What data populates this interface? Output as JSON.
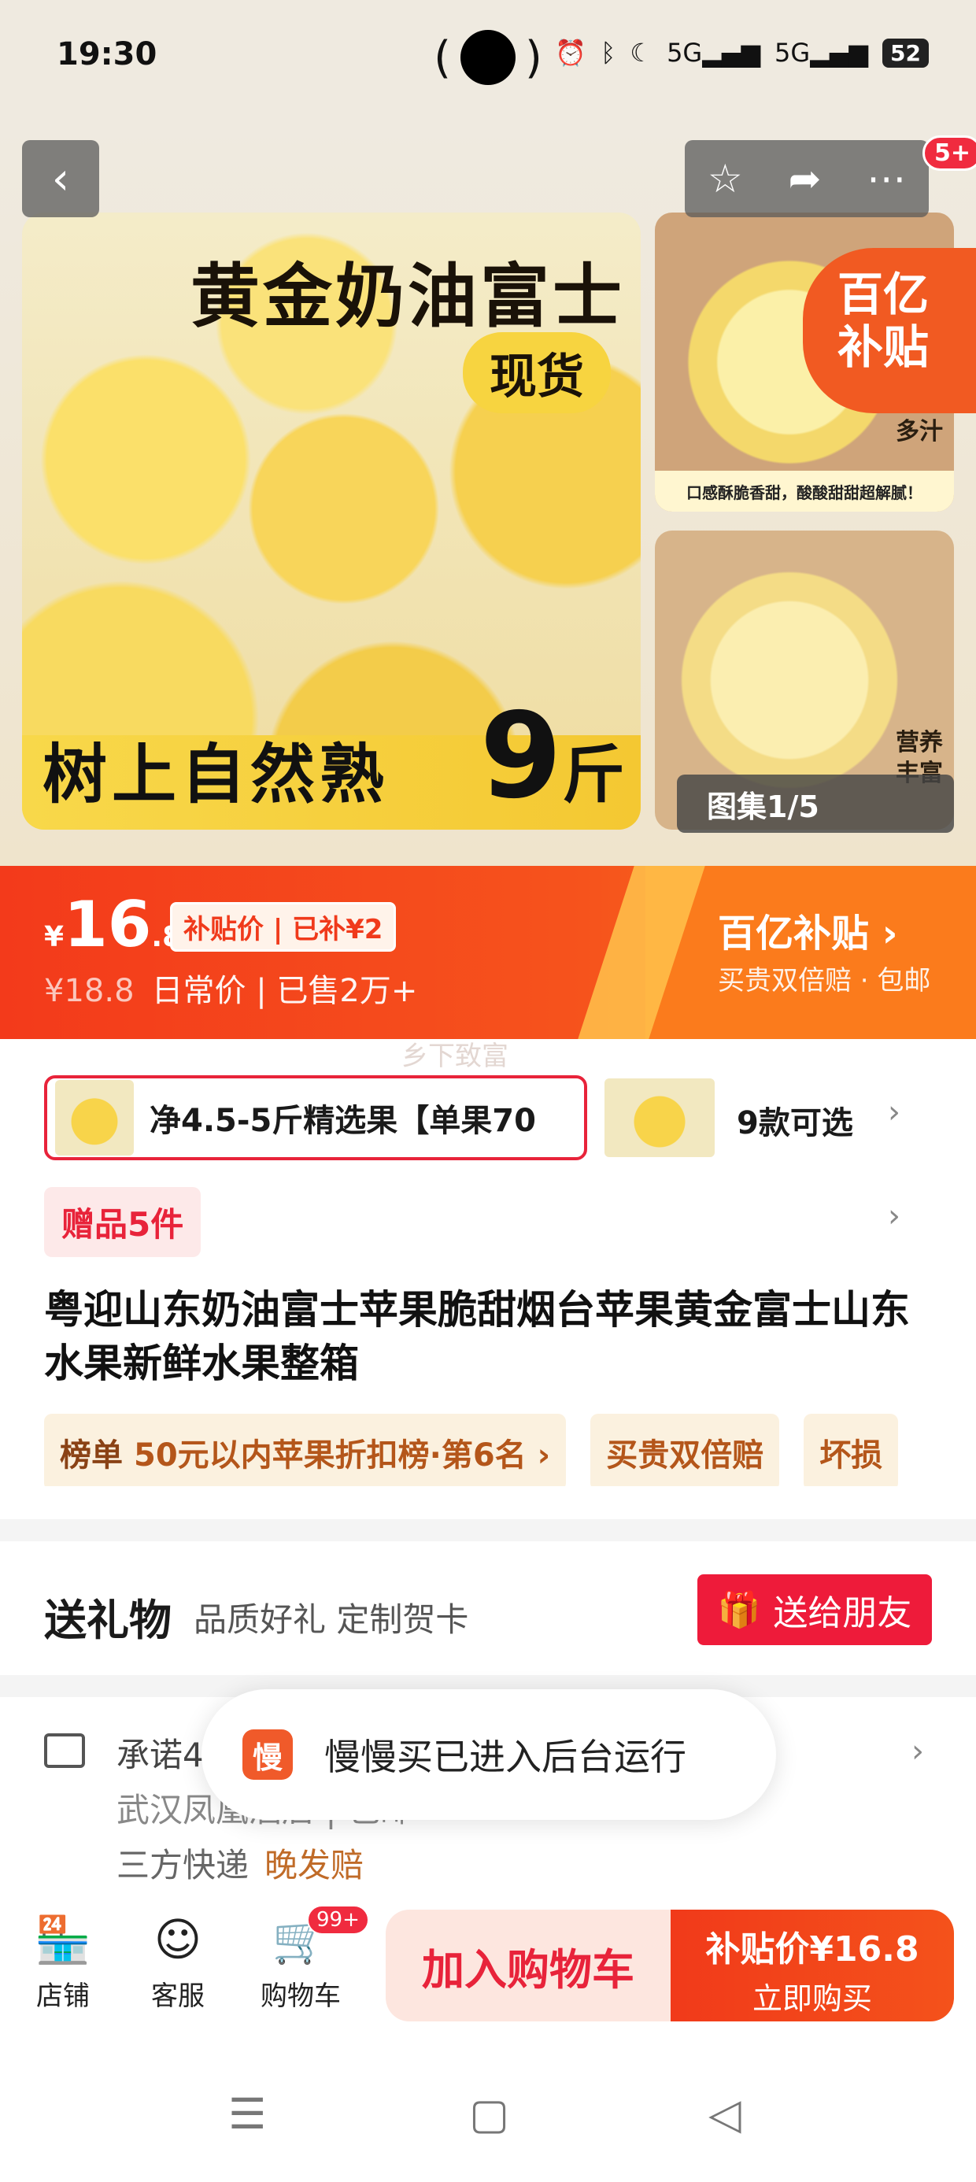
{
  "status_bar": {
    "time": "19:30",
    "camera": "( )",
    "net1": "5G",
    "net2": "5G",
    "battery": "52"
  },
  "gallery": {
    "badge": "5+",
    "main_title": "黄金奶油富士",
    "in_stock": "现货",
    "bottom_text": "树上自然熟",
    "weight_num": "9",
    "weight_unit": "斤",
    "thumb1_note": "松脆\n多汁",
    "thumb1_strip": "口感酥脆香甜，酸酸甜甜超解腻！",
    "subsidy_seal": "百亿\n补贴",
    "thumb2_note": "营养\n丰富",
    "album": "图集1/5"
  },
  "price": {
    "currency": "¥",
    "integer": "16",
    "decimal": ".8",
    "tag": "补贴价 | 已补¥2",
    "original": "¥18.8",
    "daily_label": "日常价",
    "sold": "| 已售2万+",
    "brand": "百亿补贴",
    "brand_sub": "买贵双倍赔 · 包邮"
  },
  "watermark": "乡下致富",
  "sku": {
    "selected_label": "净4.5-5斤精选果【单果70",
    "count": "9款可选"
  },
  "gift": {
    "chip": "赠品5件"
  },
  "product": {
    "title": "粤迎山东奶油富士苹果脆甜烟台苹果黄金富士山东水果新鲜水果整箱"
  },
  "chips": [
    {
      "prefix": "榜单",
      "text": "50元以内苹果折扣榜·第6名 ›"
    },
    {
      "prefix": "",
      "text": "买贵双倍赔"
    },
    {
      "prefix": "",
      "text": "坏损"
    }
  ],
  "gift_section": {
    "title": "送礼物",
    "subtitle": "品质好礼 定制贺卡",
    "button": "送给朋友"
  },
  "shipping": {
    "line1": "承诺48小时发货",
    "line2": "武汉凤凰酒店 | 包邮",
    "line3": "三方快递",
    "late": "晚发赔"
  },
  "toast": {
    "logo": "慢",
    "text": "慢慢买已进入后台运行"
  },
  "bottom_bar": {
    "shop": "店铺",
    "service": "客服",
    "cart": "购物车",
    "cart_badge": "99+",
    "add_cart": "加入购物车",
    "buy_price": "补贴价¥16.8",
    "buy_label": "立即购买"
  }
}
